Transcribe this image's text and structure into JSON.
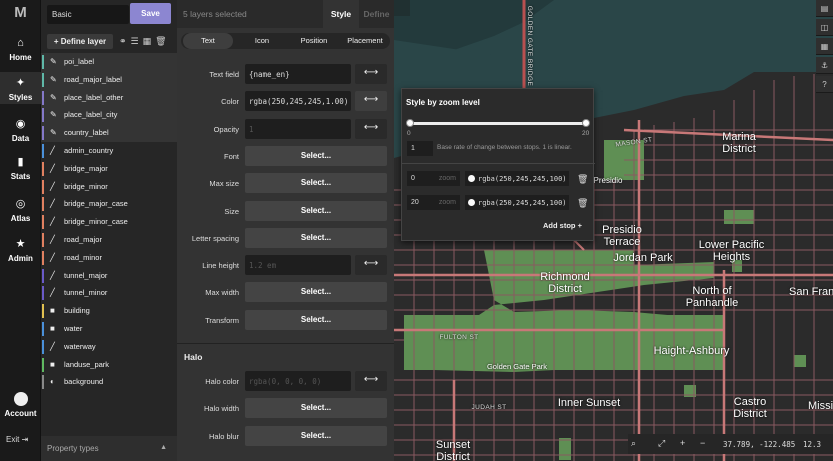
{
  "rail": {
    "logo": "M",
    "items": [
      {
        "label": "Home",
        "icon": "home-icon",
        "glyph": "⌂"
      },
      {
        "label": "Styles",
        "icon": "paint-bucket-icon",
        "glyph": "✦"
      },
      {
        "label": "Data",
        "icon": "database-icon",
        "glyph": "◉"
      },
      {
        "label": "Stats",
        "icon": "bar-chart-icon",
        "glyph": "▮"
      },
      {
        "label": "Atlas",
        "icon": "globe-icon",
        "glyph": "◎"
      },
      {
        "label": "Admin",
        "icon": "star-icon",
        "glyph": "★"
      }
    ],
    "account": "Account",
    "exit": "Exit"
  },
  "layers_panel": {
    "style_name": "Basic",
    "save_label": "Save",
    "define_layer_label": "+ Define layer",
    "layers": [
      {
        "name": "poi_label",
        "color": "#5fb8a8",
        "icon": "text-icon",
        "glyph": "✎"
      },
      {
        "name": "road_major_label",
        "color": "#5fb8a8",
        "icon": "text-icon",
        "glyph": "✎"
      },
      {
        "name": "place_label_other",
        "color": "#8478c8",
        "icon": "text-icon",
        "glyph": "✎"
      },
      {
        "name": "place_label_city",
        "color": "#8478c8",
        "icon": "text-icon",
        "glyph": "✎"
      },
      {
        "name": "country_label",
        "color": "#8478c8",
        "icon": "text-icon",
        "glyph": "✎"
      },
      {
        "name": "admin_country",
        "color": "#4a90d9",
        "icon": "line-icon",
        "glyph": "╱"
      },
      {
        "name": "bridge_major",
        "color": "#e08060",
        "icon": "line-icon",
        "glyph": "╱"
      },
      {
        "name": "bridge_minor",
        "color": "#e08060",
        "icon": "line-icon",
        "glyph": "╱"
      },
      {
        "name": "bridge_major_case",
        "color": "#e08060",
        "icon": "line-icon",
        "glyph": "╱"
      },
      {
        "name": "bridge_minor_case",
        "color": "#e08060",
        "icon": "line-icon",
        "glyph": "╱"
      },
      {
        "name": "road_major",
        "color": "#e08060",
        "icon": "line-icon",
        "glyph": "╱"
      },
      {
        "name": "road_minor",
        "color": "#e08060",
        "icon": "line-icon",
        "glyph": "╱"
      },
      {
        "name": "tunnel_major",
        "color": "#6a5ac8",
        "icon": "line-icon",
        "glyph": "╱"
      },
      {
        "name": "tunnel_minor",
        "color": "#6a5ac8",
        "icon": "line-icon",
        "glyph": "╱"
      },
      {
        "name": "building",
        "color": "#e0c050",
        "icon": "fill-icon",
        "glyph": "■"
      },
      {
        "name": "water",
        "color": "#4a90d9",
        "icon": "fill-icon",
        "glyph": "■"
      },
      {
        "name": "waterway",
        "color": "#4a90d9",
        "icon": "line-icon",
        "glyph": "╱"
      },
      {
        "name": "landuse_park",
        "color": "#5fb860",
        "icon": "fill-icon",
        "glyph": "■"
      },
      {
        "name": "background",
        "color": "#888888",
        "icon": "background-icon",
        "glyph": "◐"
      }
    ],
    "property_types": "Property types"
  },
  "editor": {
    "selection": "5 layers selected",
    "tab_style": "Style",
    "tab_define": "Define",
    "subtabs": [
      "Text",
      "Icon",
      "Position",
      "Placement"
    ],
    "props": [
      {
        "label": "Text field",
        "value": "{name_en}",
        "kind": "field"
      },
      {
        "label": "Color",
        "value": "rgba(250,245,245,1.00)",
        "kind": "field"
      },
      {
        "label": "Opacity",
        "value": "1",
        "kind": "ph"
      },
      {
        "label": "Font",
        "value": "Select...",
        "kind": "select"
      },
      {
        "label": "Max size",
        "value": "Select...",
        "kind": "select"
      },
      {
        "label": "Size",
        "value": "Select...",
        "kind": "select"
      },
      {
        "label": "Letter spacing",
        "value": "Select...",
        "kind": "select"
      },
      {
        "label": "Line height",
        "value": "1.2 em",
        "kind": "ph"
      },
      {
        "label": "Max width",
        "value": "Select...",
        "kind": "select"
      },
      {
        "label": "Transform",
        "value": "Select...",
        "kind": "select"
      }
    ],
    "halo_title": "Halo",
    "halo_props": [
      {
        "label": "Halo color",
        "value": "rgba(0, 0, 0, 0)",
        "kind": "ph"
      },
      {
        "label": "Halo width",
        "value": "Select...",
        "kind": "select"
      },
      {
        "label": "Halo blur",
        "value": "Select...",
        "kind": "select"
      }
    ]
  },
  "zoom_popup": {
    "title": "Style by zoom level",
    "min": "0",
    "max": "20",
    "base_value": "1",
    "base_text": "Base rate of change between stops. 1 is linear.",
    "unit": "zoom",
    "stops": [
      {
        "zoom": "0",
        "color": "rgba(250,245,245,100)"
      },
      {
        "zoom": "20",
        "color": "rgba(250,245,245,100)"
      }
    ],
    "add_stop": "Add stop"
  },
  "map": {
    "labels": [
      {
        "text": "Marina District"
      },
      {
        "text": "Presidio Terrace"
      },
      {
        "text": "Jordan Park"
      },
      {
        "text": "Lower Pacific Heights"
      },
      {
        "text": "Richmond District"
      },
      {
        "text": "North of Panhandle"
      },
      {
        "text": "San Fran"
      },
      {
        "text": "Haight-Ashbury"
      },
      {
        "text": "Inner Sunset"
      },
      {
        "text": "Castro District"
      },
      {
        "text": "Missi"
      },
      {
        "text": "Sunset District"
      },
      {
        "text": "Presidio"
      },
      {
        "text": "Golden Gate Park"
      },
      {
        "text": "GOLDEN GATE BRIDGE"
      },
      {
        "text": "MASON ST"
      },
      {
        "text": "FULTON ST"
      },
      {
        "text": "JUDAH ST"
      }
    ],
    "coords": "37.789, -122.485",
    "zoom": "12.3"
  }
}
